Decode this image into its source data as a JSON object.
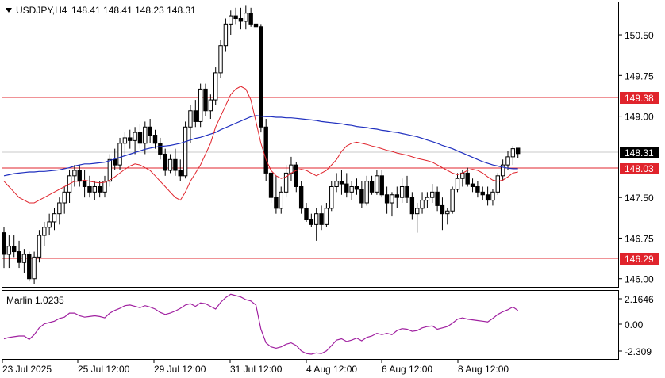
{
  "header": {
    "symbol": "USDJPY,H4",
    "ohlc": "148.41 148.41 148.23 148.31"
  },
  "indicator": {
    "label": "Marlin 1.0235",
    "ticks": [
      "2.1646",
      "0.00",
      "-2.309"
    ]
  },
  "price_labels": {
    "current": "148.31",
    "level_upper": "149.38",
    "level_mid": "148.03",
    "level_lower": "146.29"
  },
  "colors": {
    "bull": "#ffffff",
    "bear": "#000000",
    "ma_blue": "#1f2fbf",
    "ma_red": "#e0242c",
    "level_line": "#e0242c",
    "oscillator": "#a020a0"
  },
  "chart_data": [
    {
      "type": "candlestick",
      "ylim": [
        145.85,
        151.1
      ],
      "y_ticks": [
        "150.50",
        "149.75",
        "149.00",
        "147.50",
        "146.75",
        "146.00"
      ],
      "x_ticks": [
        "23 Jul 2025",
        "25 Jul 12:00",
        "29 Jul 12:00",
        "31 Jul 12:00",
        "4 Aug 12:00",
        "6 Aug 12:00",
        "8 Aug 12:00"
      ],
      "candles": [
        [
          146.85,
          146.95,
          146.2,
          146.45
        ],
        [
          146.45,
          146.8,
          146.2,
          146.6
        ],
        [
          146.6,
          146.8,
          146.4,
          146.5
        ],
        [
          146.5,
          146.7,
          146.2,
          146.3
        ],
        [
          146.3,
          146.55,
          146.1,
          146.45
        ],
        [
          146.45,
          146.5,
          145.95,
          146.0
        ],
        [
          146.0,
          146.5,
          145.9,
          146.4
        ],
        [
          146.4,
          146.9,
          146.3,
          146.8
        ],
        [
          146.8,
          147.05,
          146.6,
          146.95
        ],
        [
          146.95,
          147.2,
          146.8,
          147.05
        ],
        [
          147.05,
          147.3,
          146.9,
          147.2
        ],
        [
          147.2,
          147.5,
          147.0,
          147.4
        ],
        [
          147.4,
          147.7,
          147.2,
          147.6
        ],
        [
          147.6,
          148.0,
          147.4,
          147.9
        ],
        [
          147.9,
          148.1,
          147.7,
          148.0
        ],
        [
          148.0,
          148.1,
          147.7,
          147.8
        ],
        [
          147.8,
          148.0,
          147.5,
          147.7
        ],
        [
          147.7,
          147.9,
          147.5,
          147.6
        ],
        [
          147.6,
          147.8,
          147.45,
          147.7
        ],
        [
          147.7,
          147.8,
          147.5,
          147.6
        ],
        [
          147.6,
          147.9,
          147.5,
          147.8
        ],
        [
          147.8,
          148.3,
          147.7,
          148.2
        ],
        [
          148.2,
          148.4,
          148.0,
          148.1
        ],
        [
          148.1,
          148.6,
          148.0,
          148.5
        ],
        [
          148.5,
          148.7,
          148.3,
          148.6
        ],
        [
          148.6,
          148.75,
          148.4,
          148.55
        ],
        [
          148.55,
          148.8,
          148.3,
          148.7
        ],
        [
          148.7,
          148.85,
          148.4,
          148.5
        ],
        [
          148.5,
          148.9,
          148.3,
          148.8
        ],
        [
          148.8,
          148.95,
          148.5,
          148.65
        ],
        [
          148.65,
          148.75,
          148.4,
          148.5
        ],
        [
          148.5,
          148.6,
          148.2,
          148.3
        ],
        [
          148.3,
          148.4,
          147.9,
          148.0
        ],
        [
          148.0,
          148.3,
          147.95,
          148.2
        ],
        [
          148.2,
          148.4,
          147.9,
          148.0
        ],
        [
          148.0,
          148.2,
          147.8,
          147.9
        ],
        [
          147.9,
          148.9,
          147.85,
          148.8
        ],
        [
          148.8,
          149.2,
          148.5,
          149.1
        ],
        [
          149.1,
          149.3,
          148.8,
          148.9
        ],
        [
          148.9,
          149.6,
          148.8,
          149.5
        ],
        [
          149.5,
          149.6,
          149.0,
          149.1
        ],
        [
          149.1,
          149.4,
          148.95,
          149.3
        ],
        [
          149.3,
          149.9,
          149.2,
          149.8
        ],
        [
          149.8,
          150.4,
          149.7,
          150.3
        ],
        [
          150.3,
          150.8,
          150.2,
          150.7
        ],
        [
          150.7,
          150.95,
          150.5,
          150.85
        ],
        [
          150.85,
          151.0,
          150.7,
          150.8
        ],
        [
          150.8,
          151.0,
          150.6,
          150.75
        ],
        [
          150.75,
          151.05,
          150.6,
          150.9
        ],
        [
          150.9,
          151.0,
          150.65,
          150.7
        ],
        [
          150.7,
          150.8,
          150.5,
          150.65
        ],
        [
          150.65,
          150.7,
          148.7,
          148.8
        ],
        [
          148.8,
          148.95,
          147.8,
          147.95
        ],
        [
          147.95,
          148.0,
          147.4,
          147.5
        ],
        [
          147.5,
          147.9,
          147.2,
          147.3
        ],
        [
          147.3,
          147.7,
          147.2,
          147.6
        ],
        [
          147.6,
          148.1,
          147.5,
          147.95
        ],
        [
          147.95,
          148.25,
          147.8,
          148.1
        ],
        [
          148.1,
          148.15,
          147.6,
          147.7
        ],
        [
          147.7,
          147.8,
          147.2,
          147.3
        ],
        [
          147.3,
          147.4,
          147.05,
          147.1
        ],
        [
          147.1,
          147.2,
          146.95,
          147.0
        ],
        [
          147.0,
          147.3,
          146.7,
          147.2
        ],
        [
          147.2,
          147.35,
          146.9,
          147.0
        ],
        [
          147.0,
          147.4,
          146.95,
          147.3
        ],
        [
          147.3,
          147.8,
          147.25,
          147.7
        ],
        [
          147.7,
          147.95,
          147.6,
          147.8
        ],
        [
          147.8,
          148.0,
          147.55,
          147.75
        ],
        [
          147.75,
          147.95,
          147.5,
          147.6
        ],
        [
          147.6,
          147.8,
          147.45,
          147.7
        ],
        [
          147.7,
          147.85,
          147.55,
          147.65
        ],
        [
          147.65,
          147.8,
          147.3,
          147.4
        ],
        [
          147.4,
          147.9,
          147.35,
          147.8
        ],
        [
          147.8,
          147.9,
          147.55,
          147.6
        ],
        [
          147.6,
          148.0,
          147.55,
          147.9
        ],
        [
          147.9,
          148.0,
          147.5,
          147.55
        ],
        [
          147.55,
          147.7,
          147.2,
          147.4
        ],
        [
          147.4,
          147.6,
          147.15,
          147.55
        ],
        [
          147.55,
          147.7,
          147.3,
          147.5
        ],
        [
          147.5,
          147.85,
          147.4,
          147.7
        ],
        [
          147.7,
          147.9,
          147.4,
          147.5
        ],
        [
          147.5,
          147.6,
          147.1,
          147.2
        ],
        [
          147.2,
          147.4,
          146.85,
          147.3
        ],
        [
          147.3,
          147.6,
          147.2,
          147.45
        ],
        [
          147.45,
          147.6,
          147.3,
          147.5
        ],
        [
          147.5,
          147.75,
          147.4,
          147.6
        ],
        [
          147.6,
          147.7,
          147.25,
          147.35
        ],
        [
          147.35,
          147.5,
          146.9,
          147.2
        ],
        [
          147.2,
          147.3,
          147.0,
          147.25
        ],
        [
          147.25,
          147.7,
          147.2,
          147.65
        ],
        [
          147.65,
          147.95,
          147.6,
          147.85
        ],
        [
          147.85,
          148.0,
          147.7,
          147.95
        ],
        [
          147.95,
          148.05,
          147.7,
          147.75
        ],
        [
          147.75,
          147.85,
          147.6,
          147.7
        ],
        [
          147.7,
          147.8,
          147.5,
          147.6
        ],
        [
          147.6,
          147.7,
          147.45,
          147.55
        ],
        [
          147.55,
          147.7,
          147.35,
          147.45
        ],
        [
          147.45,
          147.65,
          147.35,
          147.6
        ],
        [
          147.6,
          147.95,
          147.55,
          147.9
        ],
        [
          147.9,
          148.2,
          147.8,
          148.1
        ],
        [
          148.1,
          148.35,
          148.0,
          148.25
        ],
        [
          148.25,
          148.45,
          148.1,
          148.4
        ],
        [
          148.41,
          148.41,
          148.23,
          148.31
        ]
      ],
      "ma_blue": [
        147.9,
        147.92,
        147.94,
        147.95,
        147.96,
        147.97,
        147.97,
        147.98,
        147.98,
        147.99,
        148.0,
        148.01,
        148.03,
        148.05,
        148.08,
        148.1,
        148.12,
        148.12,
        148.13,
        148.14,
        148.15,
        148.18,
        148.21,
        148.24,
        148.27,
        148.3,
        148.33,
        148.36,
        148.39,
        148.41,
        148.43,
        148.44,
        148.45,
        148.46,
        148.48,
        148.5,
        148.53,
        148.56,
        148.59,
        148.61,
        148.64,
        148.67,
        148.7,
        148.75,
        148.79,
        148.83,
        148.87,
        148.91,
        148.95,
        148.99,
        149.01,
        149.0,
        148.99,
        148.99,
        148.98,
        148.98,
        148.97,
        148.97,
        148.96,
        148.95,
        148.94,
        148.93,
        148.92,
        148.9,
        148.89,
        148.88,
        148.87,
        148.86,
        148.84,
        148.83,
        148.81,
        148.8,
        148.79,
        148.77,
        148.76,
        148.74,
        148.73,
        148.71,
        148.7,
        148.68,
        148.66,
        148.64,
        148.62,
        148.59,
        148.56,
        148.53,
        148.5,
        148.46,
        148.43,
        148.4,
        148.36,
        148.32,
        148.28,
        148.24,
        148.2,
        148.16,
        148.13,
        148.1,
        148.08,
        148.06,
        148.04,
        148.03,
        148.03
      ],
      "ma_red": [
        147.8,
        147.7,
        147.6,
        147.5,
        147.45,
        147.4,
        147.4,
        147.45,
        147.5,
        147.55,
        147.6,
        147.65,
        147.7,
        147.75,
        147.8,
        147.8,
        147.82,
        147.8,
        147.78,
        147.77,
        147.78,
        147.82,
        147.88,
        147.95,
        148.02,
        148.08,
        148.12,
        148.1,
        148.05,
        148.0,
        147.9,
        147.8,
        147.7,
        147.6,
        147.5,
        147.45,
        147.6,
        147.8,
        147.95,
        148.1,
        148.3,
        148.5,
        148.8,
        149.0,
        149.2,
        149.4,
        149.5,
        149.55,
        149.5,
        149.3,
        148.9,
        148.5,
        148.2,
        148.0,
        147.9,
        147.85,
        147.88,
        147.95,
        148.0,
        148.02,
        148.0,
        147.95,
        147.9,
        147.95,
        148.0,
        148.1,
        148.2,
        148.35,
        148.45,
        148.5,
        148.52,
        148.5,
        148.48,
        148.45,
        148.43,
        148.4,
        148.37,
        148.35,
        148.32,
        148.3,
        148.28,
        148.25,
        148.22,
        148.2,
        148.18,
        148.15,
        148.1,
        148.05,
        148.0,
        147.95,
        147.92,
        147.95,
        148.0,
        148.02,
        148.0,
        147.95,
        147.88,
        147.82,
        147.8,
        147.82,
        147.88,
        147.95,
        147.97
      ]
    },
    {
      "type": "line",
      "name": "Marlin 1.0235",
      "ylim": [
        -2.6,
        2.45
      ],
      "values": [
        -1.1,
        -1.0,
        -0.95,
        -0.9,
        -0.9,
        -1.15,
        -0.8,
        -0.3,
        0.0,
        0.1,
        0.2,
        0.4,
        0.5,
        0.8,
        0.8,
        0.6,
        0.5,
        0.55,
        0.6,
        0.55,
        0.45,
        0.8,
        1.0,
        1.15,
        1.35,
        1.4,
        1.3,
        1.2,
        1.35,
        1.25,
        1.1,
        0.85,
        0.7,
        0.8,
        0.95,
        1.15,
        1.4,
        1.5,
        1.3,
        1.55,
        1.5,
        1.3,
        1.1,
        1.6,
        1.95,
        2.2,
        2.1,
        2.0,
        1.8,
        1.7,
        1.4,
        -0.4,
        -1.4,
        -1.7,
        -1.8,
        -1.7,
        -1.5,
        -1.4,
        -1.6,
        -2.0,
        -2.2,
        -2.25,
        -2.15,
        -2.2,
        -2.0,
        -1.6,
        -1.2,
        -1.1,
        -1.3,
        -1.2,
        -1.05,
        -1.25,
        -1.0,
        -0.9,
        -0.7,
        -0.8,
        -0.7,
        -0.8,
        -0.5,
        -0.35,
        -0.4,
        -0.55,
        -0.5,
        -0.3,
        -0.2,
        -0.15,
        -0.4,
        -0.3,
        -0.2,
        0.05,
        0.35,
        0.45,
        0.35,
        0.3,
        0.25,
        0.2,
        0.15,
        0.4,
        0.7,
        0.9,
        1.05,
        1.25,
        1.0
      ]
    }
  ]
}
